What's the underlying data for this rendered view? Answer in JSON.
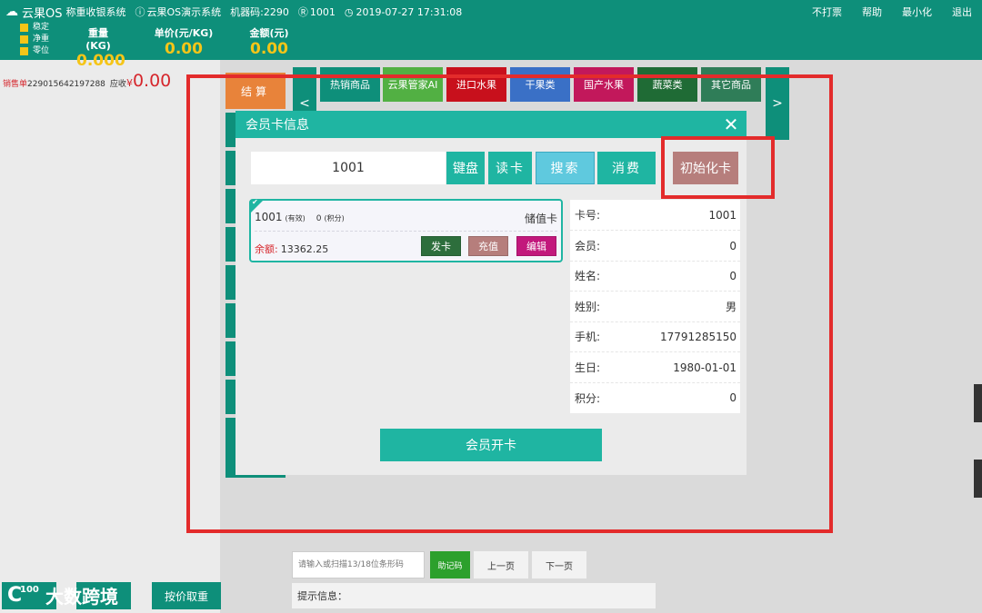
{
  "topbar": {
    "app_name": "云果OS",
    "system_name": "称重收银系统",
    "demo_system": "云果OS演示系统",
    "machine_code": "机器码:2290",
    "user": "1001",
    "datetime": "2019-07-27 17:31:08",
    "right_menu": [
      "不打票",
      "帮助",
      "最小化",
      "退出"
    ],
    "status": [
      "稳定",
      "净重",
      "零位"
    ],
    "metrics": [
      {
        "label": "重量(KG)",
        "value": "0.000"
      },
      {
        "label": "单价(元/KG)",
        "value": "0.00"
      },
      {
        "label": "金额(元)",
        "value": "0.00"
      }
    ]
  },
  "order": {
    "label": "销售单",
    "number": "229015642197288",
    "due_label": "应收",
    "currency": "¥",
    "amount": "0.00"
  },
  "checkout_label": "结算",
  "categories": [
    "热销商品",
    "云果管家AI",
    "进口水果",
    "干果类",
    "国产水果",
    "蔬菜类",
    "其它商品"
  ],
  "nav": {
    "prev": "<",
    "next": ">"
  },
  "bottom": {
    "search_placeholder": "请输入或扫描13/18位条形码",
    "jiji_label": "助记码",
    "prev_page": "上一页",
    "next_page": "下一页",
    "hint_label": "提示信息："
  },
  "bottom_left": {
    "price_label": "按价取重",
    "watermark_text": "大数跨境"
  },
  "modal": {
    "title": "会员卡信息",
    "close": "✕",
    "card_input_value": "1001",
    "buttons": [
      "键盘",
      "读卡",
      "搜索",
      "消费",
      "初始化卡"
    ],
    "card": {
      "number": "1001",
      "status": "(有效)",
      "points": "0",
      "points_label": "(积分)",
      "type": "储值卡",
      "balance_label": "余额:",
      "balance": "13362.25",
      "actions": [
        "发卡",
        "充值",
        "编辑"
      ]
    },
    "info": [
      {
        "label": "卡号:",
        "value": "1001"
      },
      {
        "label": "会员:",
        "value": "0"
      },
      {
        "label": "姓名:",
        "value": "0"
      },
      {
        "label": "姓别:",
        "value": "男"
      },
      {
        "label": "手机:",
        "value": "17791285150"
      },
      {
        "label": "生日:",
        "value": "1980-01-01"
      },
      {
        "label": "积分:",
        "value": "0"
      }
    ],
    "open_card_label": "会员开卡"
  },
  "colors": {
    "topbar": "#0e8f7a",
    "accent": "#1fb5a2",
    "highlight": "#f5c518",
    "annotation": "#e32b2b"
  }
}
